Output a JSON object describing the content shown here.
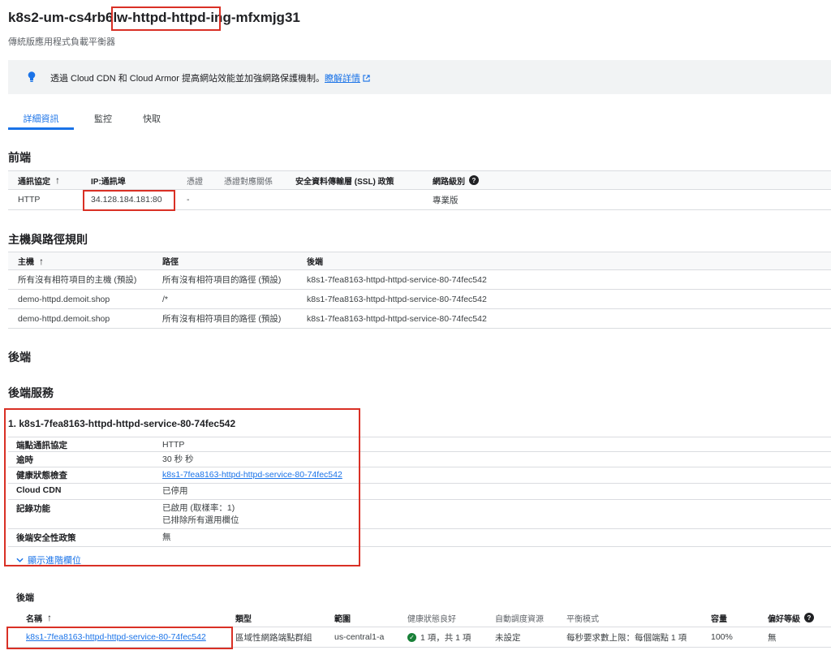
{
  "header": {
    "title": "k8s2-um-cs4rb6lw-httpd-httpd-ing-mfxmjg31",
    "subtitle": "傳統版應用程式負載平衡器"
  },
  "banner": {
    "text": "透過 Cloud CDN 和 Cloud Armor 提高網站效能並加強網路保護機制。",
    "link": "瞭解詳情"
  },
  "tabs": [
    {
      "label": "詳細資訊"
    },
    {
      "label": "監控"
    },
    {
      "label": "快取"
    }
  ],
  "frontend": {
    "heading": "前端",
    "columns": [
      "通訊協定",
      "IP:通訊埠",
      "憑證",
      "憑證對應關係",
      "安全資料傳輸層 (SSL) 政策",
      "網路級別"
    ],
    "rows": [
      [
        "HTTP",
        "34.128.184.181:80",
        "-",
        "",
        "",
        "專業版"
      ]
    ]
  },
  "host_rules": {
    "heading": "主機與路徑規則",
    "columns": [
      "主機",
      "路徑",
      "後端"
    ],
    "rows": [
      [
        "所有沒有相符項目的主機 (預設)",
        "所有沒有相符項目的路徑 (預設)",
        "k8s1-7fea8163-httpd-httpd-service-80-74fec542"
      ],
      [
        "demo-httpd.demoit.shop",
        "/*",
        "k8s1-7fea8163-httpd-httpd-service-80-74fec542"
      ],
      [
        "demo-httpd.demoit.shop",
        "所有沒有相符項目的路徑 (預設)",
        "k8s1-7fea8163-httpd-httpd-service-80-74fec542"
      ]
    ]
  },
  "backend": {
    "heading": "後端",
    "services_heading": "後端服務",
    "service_title": "1. k8s1-7fea8163-httpd-httpd-service-80-74fec542",
    "props": [
      {
        "label": "端點通訊協定",
        "value": "HTTP"
      },
      {
        "label": "逾時",
        "value": "30 秒 秒"
      },
      {
        "label": "健康狀態檢查",
        "value": "k8s1-7fea8163-httpd-httpd-service-80-74fec542"
      },
      {
        "label": "Cloud CDN",
        "value": "已停用"
      },
      {
        "label": "記錄功能",
        "value": "已啟用 (取樣率：1)",
        "value2": "已排除所有選用欄位"
      },
      {
        "label": "後端安全性政策",
        "value": "無"
      }
    ],
    "advanced_label": "顯示進階欄位",
    "sub_heading": "後端",
    "columns": [
      "名稱",
      "類型",
      "範圍",
      "健康狀態良好",
      "自動調度資源",
      "平衡模式",
      "容量",
      "偏好等級"
    ],
    "rows": [
      [
        "k8s1-7fea8163-httpd-httpd-service-80-74fec542",
        "區域性網路端點群組",
        "us-central1-a",
        "1 項，共 1 項",
        "未設定",
        "每秒要求數上限：每個端點 1 項",
        "100%",
        "無"
      ]
    ]
  },
  "colors": {
    "accent": "#1a73e8",
    "highlight": "#d93025",
    "healthy": "#188038"
  }
}
